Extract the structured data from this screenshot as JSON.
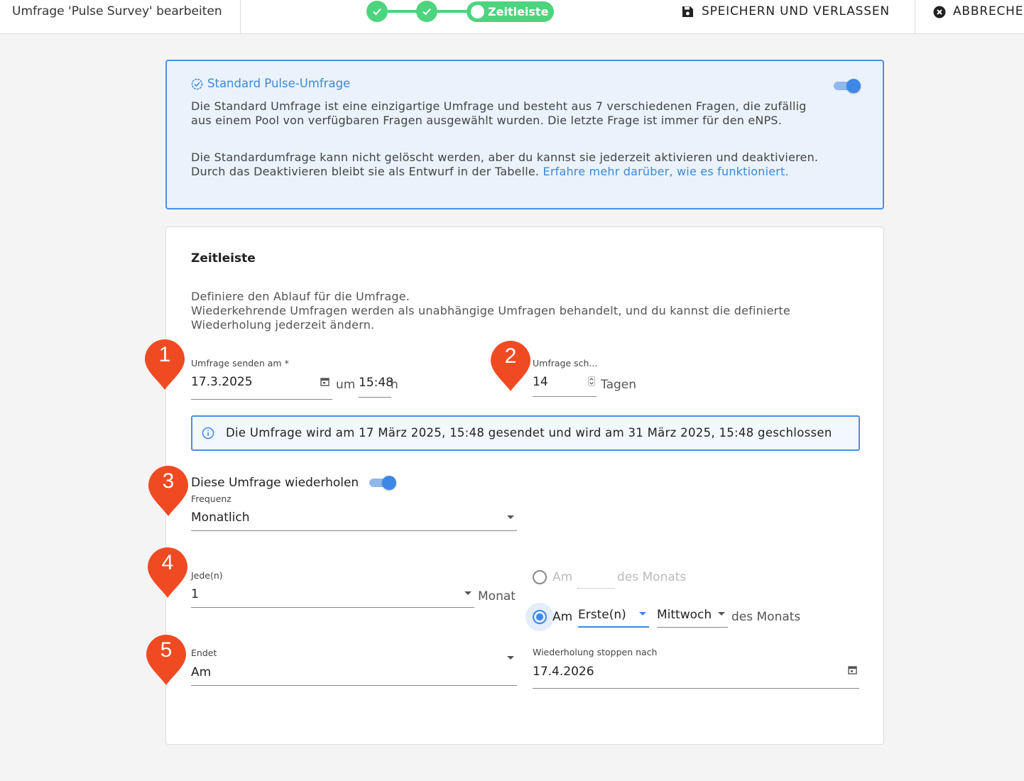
{
  "header": {
    "title": "Umfrage 'Pulse Survey' bearbeiten",
    "current_step": "Zeitleiste",
    "save_label": "SPEICHERN UND VERLASSEN",
    "cancel_label": "ABBRECHE"
  },
  "info": {
    "title": "Standard Pulse-Umfrage",
    "p1": "Die Standard Umfrage ist eine einzigartige Umfrage und besteht aus 7 verschiedenen Fragen, die zufällig aus einem Pool von verfügbaren Fragen ausgewählt wurden. Die letzte Frage ist immer für den eNPS.",
    "p2": "Die Standardumfrage kann nicht gelöscht werden, aber du kannst sie jederzeit aktivieren und deaktivieren. Durch das Deaktivieren bleibt sie als Entwurf in der Tabelle.",
    "link": "Erfahre mehr darüber, wie es funktioniert.",
    "toggle_on": true
  },
  "timeline": {
    "title": "Zeitleiste",
    "desc_line1": "Definiere den Ablauf für die Umfrage.",
    "desc_line2": "Wiederkehrende Umfragen werden als unabhängige Umfragen behandelt, und du kannst die definierte Wiederholung jederzeit ändern.",
    "send_label": "Umfrage senden am *",
    "send_date": "17.3.2025",
    "at_label": "um",
    "time": "15:48",
    "time_unit": "h",
    "close_label": "Umfrage sch...",
    "close_days": "14",
    "days_label": "Tagen",
    "notice": "Die Umfrage wird am 17 März 2025, 15:48 gesendet und wird am 31 März 2025, 15:48 geschlossen",
    "repeat_label": "Diese Umfrage wiederholen",
    "repeat_on": true,
    "freq_label": "Frequenz",
    "freq_value": "Monatlich",
    "every_label": "Jede(n)",
    "every_value": "1",
    "every_unit": "Monat",
    "opt1_am": "Am",
    "opt1_suffix": "des Monats",
    "opt2_am": "Am",
    "opt2_ordinal": "Erste(n)",
    "opt2_weekday": "Mittwoch",
    "opt2_suffix": "des Monats",
    "ends_label": "Endet",
    "ends_value": "Am",
    "stop_label": "Wiederholung stoppen nach",
    "stop_date": "17.4.2026"
  },
  "markers": [
    "1",
    "2",
    "3",
    "4",
    "5"
  ],
  "colors": {
    "accent": "#3d88e6",
    "success": "#4cd47e",
    "marker": "#f04a23"
  }
}
